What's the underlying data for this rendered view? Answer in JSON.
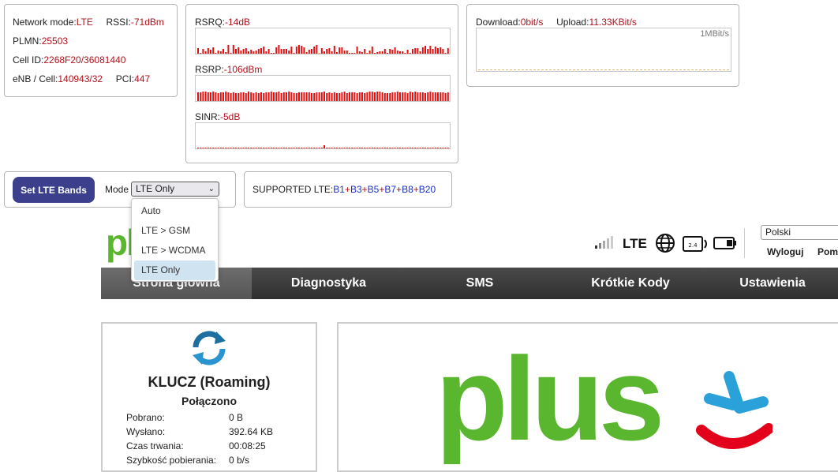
{
  "signal": {
    "network_mode_label": "Network mode:",
    "network_mode": "LTE",
    "rssi_label": "RSSI:",
    "rssi": "-71dBm",
    "plmn_label": "PLMN:",
    "plmn": "25503",
    "cellid_label": "Cell ID:",
    "cellid": "2268F20/36081440",
    "enb_label": "eNB / Cell:",
    "enb": "140943/32",
    "pci_label": "PCI:",
    "pci": "447"
  },
  "graphs": {
    "rsrq_label": "RSRQ:",
    "rsrq": "-14dB",
    "rsrp_label": "RSRP:",
    "rsrp": "-106dBm",
    "sinr_label": "SINR:",
    "sinr": "-5dB"
  },
  "traffic": {
    "download_label": "Download:",
    "download": "0bit/s",
    "upload_label": "Upload:",
    "upload": "11.33KBit/s",
    "scale": "1MBit/s"
  },
  "bands": {
    "button_label": "Set LTE Bands",
    "mode_label": "Mode",
    "mode_value": "LTE Only",
    "options": [
      "Auto",
      "LTE > GSM",
      "LTE > WCDMA",
      "LTE Only"
    ],
    "supported_label": "SUPPORTED LTE:",
    "supported": [
      "B1",
      "B3",
      "B5",
      "B7",
      "B8",
      "B20"
    ]
  },
  "router": {
    "logo_fragment": "pl",
    "network_type": "LTE",
    "language": "Polski",
    "logout": "Wyloguj",
    "help": "Pom",
    "nav": [
      "Strona główna",
      "Diagnostyka",
      "SMS",
      "Krótkie Kody",
      "Ustawienia"
    ],
    "device_name": "KLUCZ (Roaming)",
    "status": "Połączono",
    "stats": [
      {
        "label": "Pobrano:",
        "value": "0 B"
      },
      {
        "label": "Wysłano:",
        "value": "392.64 KB"
      },
      {
        "label": "Czas trwania:",
        "value": "00:08:25"
      },
      {
        "label": "Szybkość pobierania:",
        "value": "0 b/s"
      }
    ],
    "banner_text": "plus",
    "battery_icon": "battery-icon",
    "globe_icon": "globe-icon",
    "signal_icon": "signal-bars-icon",
    "brand_green": "#5ab52f",
    "brand_blue": "#2aa1d8",
    "brand_red": "#e3001b"
  }
}
